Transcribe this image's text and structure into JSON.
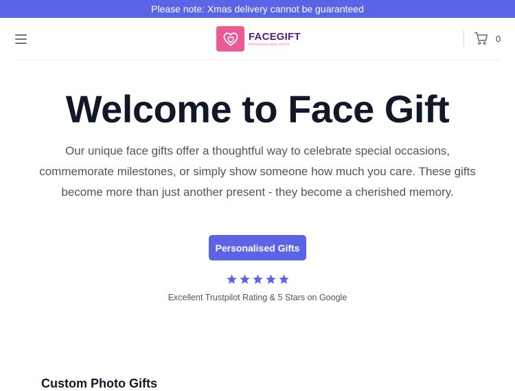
{
  "announcement": {
    "text": "Please note: Xmas delivery cannot be guaranteed"
  },
  "header": {
    "menu_icon": "hamburger-menu-icon",
    "logo": {
      "name": "FACEGIFT",
      "tagline": "PERSONALISED GIFTS",
      "icon": "heart-logo-icon"
    },
    "cart": {
      "icon": "shopping-cart-icon",
      "count": "0"
    }
  },
  "hero": {
    "title": "Welcome to Face Gift",
    "body": "Our unique face gifts offer a thoughtful way to celebrate special occasions, commemorate milestones, or simply show someone how much you care. These gifts become more than just another present - they become a cherished memory.",
    "cta_label": "Personalised Gifts",
    "rating": {
      "stars": 5,
      "max_stars": 5,
      "text": "Excellent Trustpilot Rating & 5 Stars on Google"
    }
  },
  "section": {
    "heading": "Custom Photo Gifts"
  },
  "colors": {
    "accent": "#5b63e6",
    "logo_pink": "#ea5a95",
    "logo_purple": "#55207a",
    "heading": "#111827",
    "body_text": "#4b5563"
  }
}
